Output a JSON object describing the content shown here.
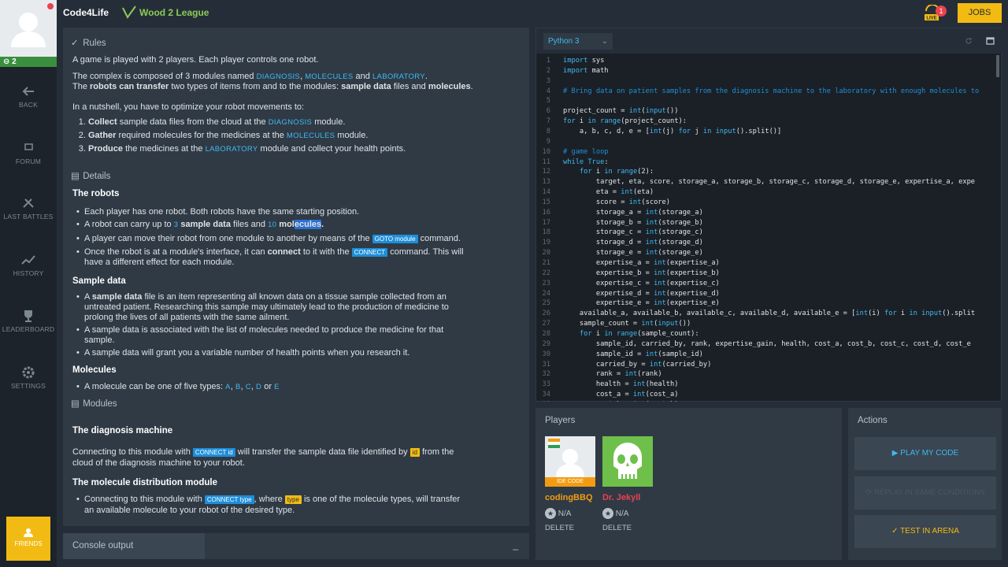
{
  "sidebar": {
    "level": "2",
    "items": [
      {
        "label": "BACK",
        "icon": "back-arrow-icon"
      },
      {
        "label": "FORUM",
        "icon": "forum-icon"
      },
      {
        "label": "LAST BATTLES",
        "icon": "battles-icon"
      },
      {
        "label": "HISTORY",
        "icon": "history-icon"
      },
      {
        "label": "LEADERBOARD",
        "icon": "trophy-icon"
      },
      {
        "label": "SETTINGS",
        "icon": "gear-icon"
      }
    ],
    "friends_label": "FRIENDS"
  },
  "topbar": {
    "brand": "Code4Life",
    "league": "Wood 2 League",
    "live_label": "LIVE",
    "live_count": "1",
    "jobs_label": "JOBS"
  },
  "statement": {
    "rules_title": "Rules",
    "rules_p1": "A game is played with 2 players. Each player controls one robot.",
    "rules_p2_a": "The complex is composed of 3 modules named ",
    "mod_diag": "DIAGNOSIS",
    "sep1": ", ",
    "mod_mol": "MOLECULES",
    "sep2": " and ",
    "mod_lab": "LABORATORY",
    "end_dot": ".",
    "rules_p3_a": "The ",
    "rules_p3_b": "robots can transfer",
    "rules_p3_c": " two types of items from and to the modules: ",
    "rules_p3_d": "sample data",
    "rules_p3_e": " files and ",
    "rules_p3_f": "molecules",
    "rules_p3_g": ".",
    "nutshell": "In a nutshell, you have to optimize your robot movements to:",
    "step1_a": "Collect",
    "step1_b": " sample data files from the cloud at the ",
    "step1_c": " module.",
    "step2_a": "Gather",
    "step2_b": " required molecules for the medicines at the ",
    "step2_c": " module.",
    "step3_a": "Produce",
    "step3_b": " the medicines at the ",
    "step3_c": " module and collect your health points.",
    "details_title": "Details",
    "robots_title": "The robots",
    "r1": "Each player has one robot. Both robots have the same starting position.",
    "r2_a": "A robot can carry up to ",
    "r2_n1": "3",
    "r2_b": " sample data",
    "r2_c": " files and ",
    "r2_n2": "10",
    "r2_d": " ",
    "r2_e": "mol",
    "r2_f": "ecules",
    "r2_g": ".",
    "r3_a": "A player can move their robot from one module to another by means of the ",
    "r3_tag": "GOTO module",
    "r3_b": " command.",
    "r4_a": "Once the robot is at a module's interface, it can ",
    "r4_b": "connect",
    "r4_c": " to it with the ",
    "r4_tag": "CONNECT",
    "r4_d": " command. This will",
    "r4_e": "have a different effect for each module.",
    "sample_title": "Sample data",
    "s1_a": "A ",
    "s1_b": "sample data",
    "s1_c": " file is an item representing all known data on a tissue sample collected from an",
    "s1_d": "untreated patient. Researching this sample may ultimately lead to the production of medicine to",
    "s1_e": "prolong the lives of all patients with the same ailment.",
    "s2_a": "A sample data is associated with the list of molecules needed to produce the medicine for that",
    "s2_b": "sample.",
    "s3": "A sample data will grant you a variable number of health points when you research it.",
    "mol_title": "Molecules",
    "m1_a": "A molecule can be one of five types: ",
    "mA": "A",
    "mB": "B",
    "mC": "C",
    "mD": "D",
    "mE": "E",
    "m1_or": " or ",
    "comma": ", ",
    "modules_title": "Modules",
    "diag_title": "The diagnosis machine",
    "d1_a": "Connecting to this module with ",
    "d1_tag": "CONNECT id",
    "d1_b": " will transfer the sample data file identified by ",
    "d1_tag2": "id",
    "d1_c": " from the",
    "d1_d": "cloud of the diagnosis machine to your robot.",
    "moldist_title": "The molecule distribution module",
    "md1_a": "Connecting to this module with ",
    "md1_tag": "CONNECT type",
    "md1_b": ", where ",
    "md1_tag2": "type",
    "md1_c": " is one of the molecule types, will transfer",
    "md1_d": "an available molecule to your robot of the desired type."
  },
  "console": {
    "title": "Console output",
    "minimize": "_"
  },
  "ide": {
    "language": "Python 3",
    "lines": [
      "import sys",
      "import math",
      "",
      "# Bring data on patient samples from the diagnosis machine to the laboratory with enough molecules to",
      "",
      "project_count = int(input())",
      "for i in range(project_count):",
      "    a, b, c, d, e = [int(j) for j in input().split()]",
      "",
      "# game loop",
      "while True:",
      "    for i in range(2):",
      "        target, eta, score, storage_a, storage_b, storage_c, storage_d, storage_e, expertise_a, expe",
      "        eta = int(eta)",
      "        score = int(score)",
      "        storage_a = int(storage_a)",
      "        storage_b = int(storage_b)",
      "        storage_c = int(storage_c)",
      "        storage_d = int(storage_d)",
      "        storage_e = int(storage_e)",
      "        expertise_a = int(expertise_a)",
      "        expertise_b = int(expertise_b)",
      "        expertise_c = int(expertise_c)",
      "        expertise_d = int(expertise_d)",
      "        expertise_e = int(expertise_e)",
      "    available_a, available_b, available_c, available_d, available_e = [int(i) for i in input().split",
      "    sample_count = int(input())",
      "    for i in range(sample_count):",
      "        sample_id, carried_by, rank, expertise_gain, health, cost_a, cost_b, cost_c, cost_d, cost_e",
      "        sample_id = int(sample_id)",
      "        carried_by = int(carried_by)",
      "        rank = int(rank)",
      "        health = int(health)",
      "        cost_a = int(cost_a)",
      "        cost_b = int(cost_b)"
    ]
  },
  "players": {
    "title": "Players",
    "list": [
      {
        "name": "codingBBQ",
        "badge": "IDE CODE",
        "rank": "N/A",
        "delete": "DELETE"
      },
      {
        "name": "Dr. Jekyll",
        "rank": "N/A",
        "delete": "DELETE"
      }
    ]
  },
  "actions": {
    "title": "Actions",
    "play": "PLAY MY CODE",
    "replay": "REPLAY IN SAME CONDITIONS",
    "test": "TEST IN ARENA"
  },
  "colors": {
    "accent": "#f2bb13",
    "keyword": "#40b8f0",
    "league": "#8bcc59",
    "player_name": "#e9434f"
  }
}
